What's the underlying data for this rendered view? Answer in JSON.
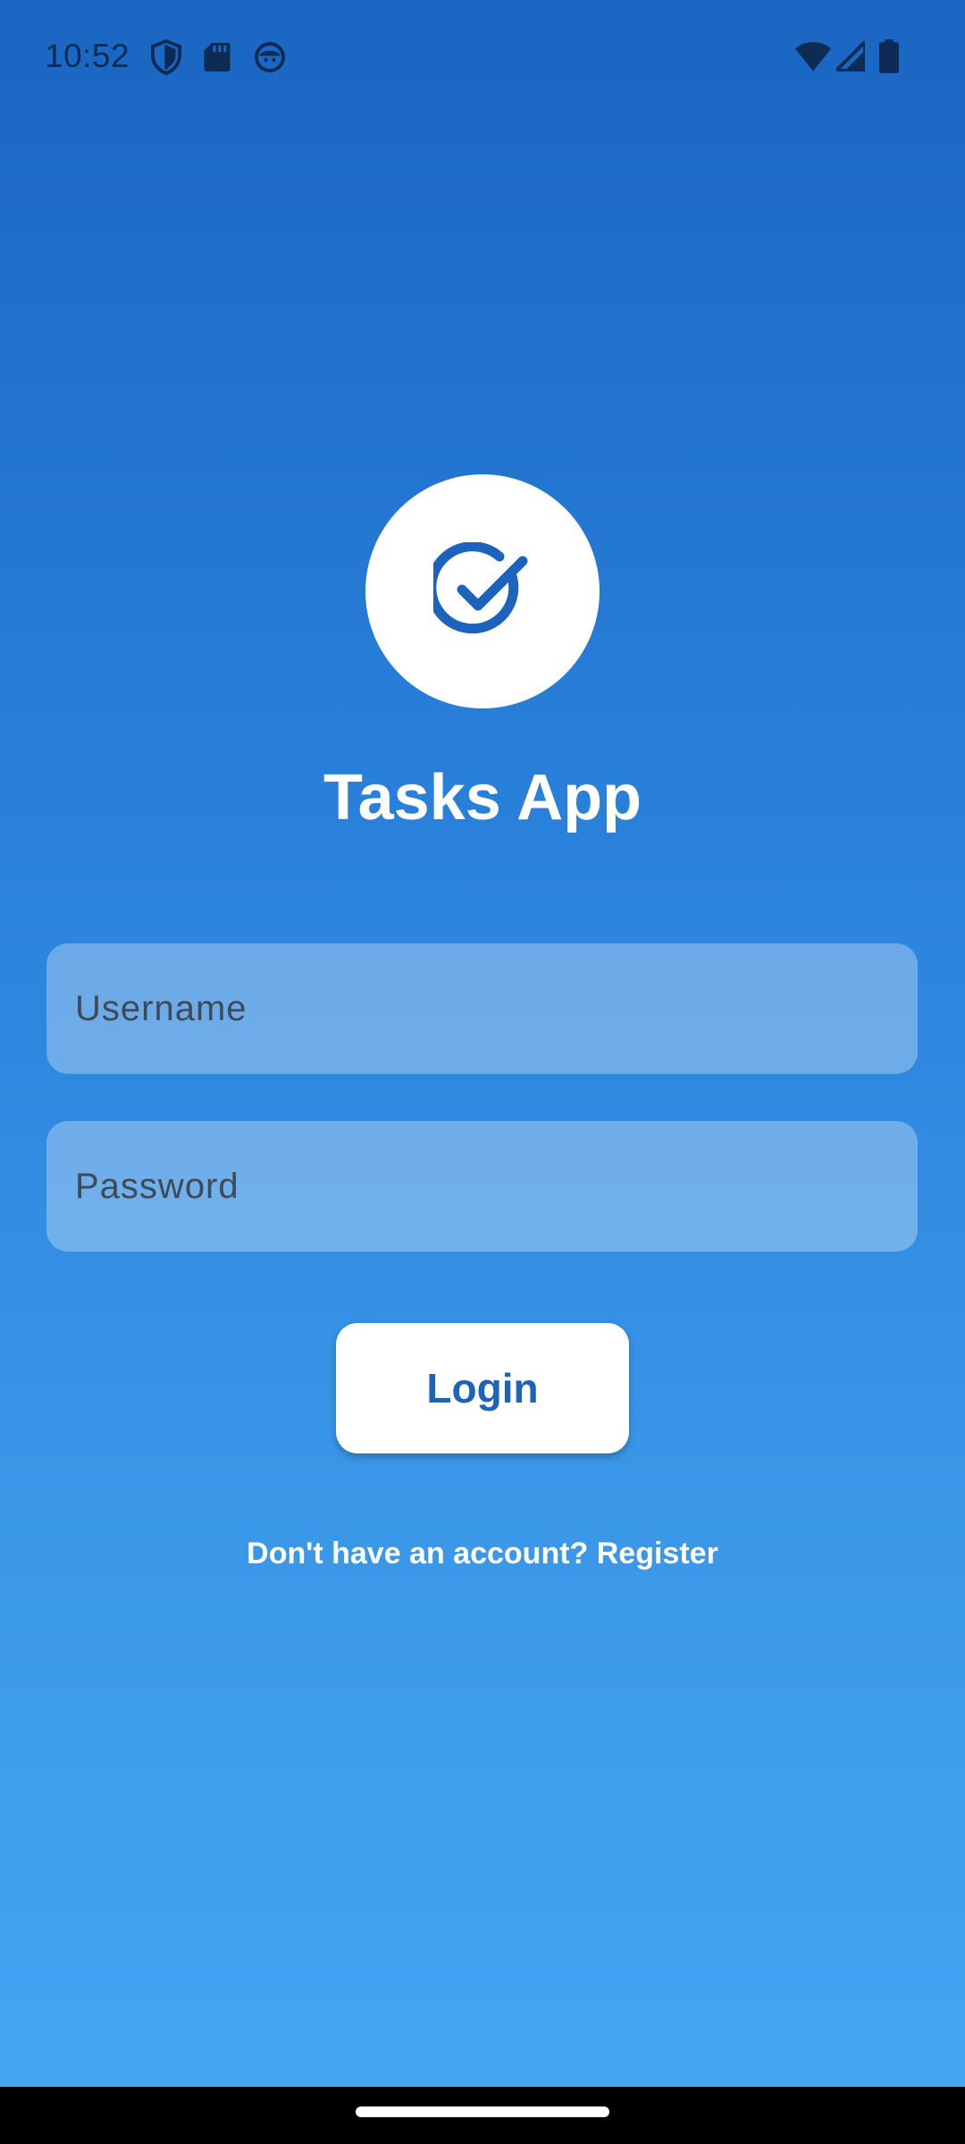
{
  "status_bar": {
    "time": "10:52",
    "left_icons": [
      "shield-icon",
      "sd-card-icon",
      "face-icon"
    ],
    "right_icons": [
      "wifi-icon",
      "signal-icon",
      "battery-icon"
    ]
  },
  "logo": {
    "icon": "check-circle-icon",
    "color": "#1b63bd"
  },
  "title": "Tasks App",
  "form": {
    "username_placeholder": "Username",
    "username_value": "",
    "password_placeholder": "Password",
    "password_value": ""
  },
  "login_label": "Login",
  "register_text": "Don't have an account? Register",
  "colors": {
    "accent": "#1b63bd",
    "gradient_top": "#1a66c2",
    "gradient_bottom": "#46a6f4"
  }
}
